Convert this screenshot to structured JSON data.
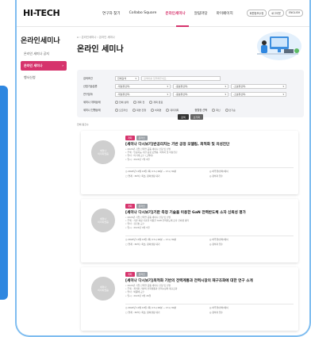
{
  "header": {
    "logo": "HI-TECH",
    "nav": [
      "연구자 찾기",
      "Collabo Square",
      "온라인세미나",
      "알림마당",
      "마이페이지"
    ],
    "active_nav": "온라인세미나",
    "util": [
      "회원정보수정",
      "로그아웃",
      "ENGLISH"
    ]
  },
  "sidebar": {
    "title": "온라인세미나",
    "items": [
      {
        "label": "온라인 세미나 공지"
      },
      {
        "label": "온라인 세미나"
      },
      {
        "label": "행사신청"
      }
    ],
    "active_item_arrow": "›"
  },
  "main": {
    "breadcrumb": "⌂  › 온라인세미나  › 온라인 세미나",
    "page_title": "온라인 세미나"
  },
  "filter": {
    "rows": [
      {
        "label": "검색조건",
        "selects": [
          "전체검색"
        ],
        "input_placeholder": "검색어를 입력해주세요."
      },
      {
        "label": "산업기술분류",
        "selects": [
          "-대분류선택-",
          "-중분류선택-",
          "-소분류선택-"
        ]
      },
      {
        "label": "연구분야",
        "selects": [
          "-대분류선택-",
          "-중분류선택-",
          "-소분류선택-"
        ]
      },
      {
        "label": "세미나 개최상태",
        "checks": [
          "전체 상태",
          "개최 전",
          "개최 완료"
        ]
      },
      {
        "label": "세미나 진행상태",
        "checks": [
          "오프라인",
          "대면 진행",
          "비대면",
          "대리개최"
        ],
        "sort_label": "정렬정 선택",
        "sort_checks": [
          "최신",
          "인기순"
        ]
      }
    ],
    "search_button": "검색",
    "reset_button": "초기화"
  },
  "results": {
    "count_text": "전체 총건수",
    "cards": [
      {
        "badge_a": "개최",
        "badge_b": "온라인",
        "thumb_text": "세미나\n이미지없음",
        "title": "[세미나 다시보기]반공리치는 기반 공정 모델링, 최적화 및 의성진단",
        "meta": [
          "• 2024년 기업 산학연 공동 세미나 신청 및 선발",
          "• 주제 : 인공지능 기반 공정 모델링, 최적화 및 이상진단",
          "• 연사 : 이기재 교수 (고려대)",
          "• 일시 : 2024년 7월 9일"
        ],
        "info": [
          "◷  2024년 10월 16일 (목) 17시 00분 ~ 17시 30분",
          "◎  하루행(센터)에서",
          "▢  연계 : 30석 / 최초, 참여설정 대기",
          "◎  참석자 접수"
        ]
      },
      {
        "badge_a": "개최",
        "badge_b": "온라인",
        "thumb_text": "세미나\n이미지없음",
        "title": "[세미나 다시보기]기판 측정 기술을 이용한 GaN 전력반도체 소자 신뢰성 평가",
        "meta": [
          "• 2024년 기업 산학연 공동 세미나 신청 및 선발",
          "• 주제 : 기판 측정 기술을 이용한 GaN 전력반도체 소자 신뢰성 평가",
          "• 연사 : 김진호 교수",
          "• 일시 : 2024년 9월 5일"
        ],
        "info": [
          "◷  2024년 10월 16일 (목) 17시 00분 ~ 17시 30분",
          "◎  하루행(센터)에서",
          "▢  연계 : 30석 / 최초, 참여설정 대기",
          "◎  참석자 접수"
        ]
      },
      {
        "badge_a": "개최",
        "badge_b": "온라인",
        "thumb_text": "세미나\n이미지없음",
        "title": "[세미나 다시보기]최적화 기반의 전력계통과 전력시장의 재구조화에 대한 연구 소개",
        "meta": [
          "• 2024년 기업 산학연 공동 세미나 신청 및 선발",
          "• 주제 : 최적화 기반의 전력계통과 전력시장의 재구조화",
          "• 연사 : 박종배 교수",
          "• 일시 : 2024년 9월 26일"
        ],
        "info": [
          "◷  2024년 10월 16일 (목) 17시 00분 ~ 17시 30분",
          "◎  하루행(센터)에서",
          "▢  연계 : 30석 / 최초, 참여설정 대기",
          "◎  참석자 접수"
        ]
      }
    ]
  },
  "colors": {
    "accent": "#d6336c",
    "frame": "#7fbdf0",
    "left_strip": "#2f87e0"
  }
}
